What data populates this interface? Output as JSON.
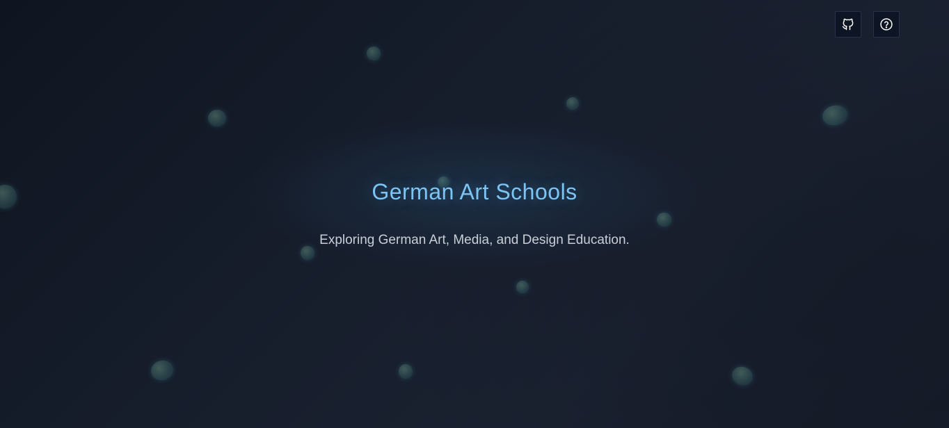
{
  "hero": {
    "title": "German Art Schools",
    "subtitle": "Exploring German Art, Media, and Design Education."
  },
  "header": {
    "buttons": [
      {
        "icon": "github-icon"
      },
      {
        "icon": "help-icon"
      }
    ]
  },
  "colors": {
    "title": "#7cc4f4",
    "subtitle": "#c9cfd8",
    "background": "#161d2b",
    "button_bg": "#0d1524",
    "bubble": "#4f8a86"
  }
}
